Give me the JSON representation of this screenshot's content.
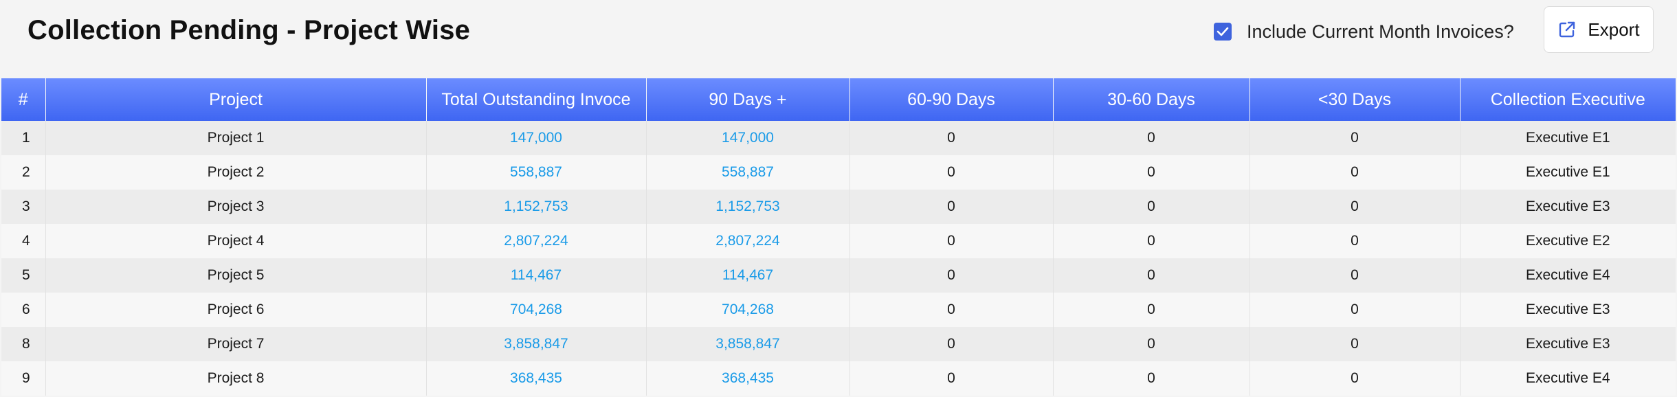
{
  "header": {
    "title": "Collection Pending - Project Wise",
    "include_label": "Include Current Month Invoices?",
    "include_checked": true,
    "export_label": "Export",
    "export_icon": "external-link-icon"
  },
  "table": {
    "columns": [
      "#",
      "Project",
      "Total Outstanding Invoce",
      "90 Days +",
      "60-90 Days",
      "30-60 Days",
      "<30 Days",
      "Collection Executive"
    ],
    "rows": [
      {
        "num": "1",
        "project": "Project 1",
        "total": "147,000",
        "d90": "147,000",
        "d60_90": "0",
        "d30_60": "0",
        "lt30": "0",
        "executive": "Executive E1"
      },
      {
        "num": "2",
        "project": "Project 2",
        "total": "558,887",
        "d90": "558,887",
        "d60_90": "0",
        "d30_60": "0",
        "lt30": "0",
        "executive": "Executive E1"
      },
      {
        "num": "3",
        "project": "Project 3",
        "total": "1,152,753",
        "d90": "1,152,753",
        "d60_90": "0",
        "d30_60": "0",
        "lt30": "0",
        "executive": "Executive E3"
      },
      {
        "num": "4",
        "project": "Project 4",
        "total": "2,807,224",
        "d90": "2,807,224",
        "d60_90": "0",
        "d30_60": "0",
        "lt30": "0",
        "executive": "Executive E2"
      },
      {
        "num": "5",
        "project": "Project 5",
        "total": "114,467",
        "d90": "114,467",
        "d60_90": "0",
        "d30_60": "0",
        "lt30": "0",
        "executive": "Executive E4"
      },
      {
        "num": "6",
        "project": "Project 6",
        "total": "704,268",
        "d90": "704,268",
        "d60_90": "0",
        "d30_60": "0",
        "lt30": "0",
        "executive": "Executive E3"
      },
      {
        "num": "8",
        "project": "Project 7",
        "total": "3,858,847",
        "d90": "3,858,847",
        "d60_90": "0",
        "d30_60": "0",
        "lt30": "0",
        "executive": "Executive E3"
      },
      {
        "num": "9",
        "project": "Project 8",
        "total": "368,435",
        "d90": "368,435",
        "d60_90": "0",
        "d30_60": "0",
        "lt30": "0",
        "executive": "Executive E4"
      }
    ]
  },
  "colors": {
    "header_gradient_top": "#6b8cff",
    "header_gradient_bottom": "#3f66f2",
    "link": "#1a9be8",
    "checkbox": "#3e63dd"
  }
}
